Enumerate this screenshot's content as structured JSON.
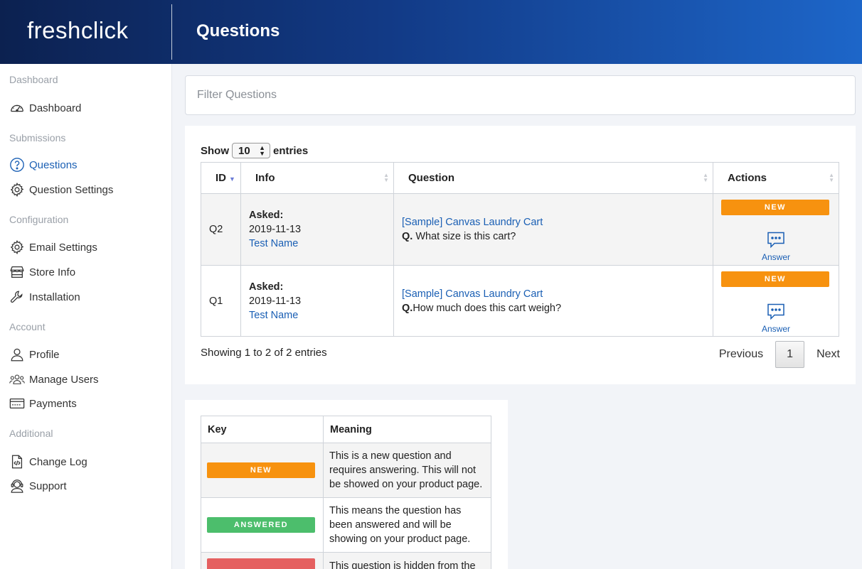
{
  "app": {
    "logo": "freshclick",
    "page_title": "Questions"
  },
  "sidebar": {
    "sections": [
      {
        "label": "Dashboard",
        "items": [
          {
            "label": "Dashboard",
            "icon": "gauge-icon"
          }
        ]
      },
      {
        "label": "Submissions",
        "items": [
          {
            "label": "Questions",
            "icon": "question-circle-icon",
            "active": true
          },
          {
            "label": "Question Settings",
            "icon": "gear-icon"
          }
        ]
      },
      {
        "label": "Configuration",
        "items": [
          {
            "label": "Email Settings",
            "icon": "gear-icon"
          },
          {
            "label": "Store Info",
            "icon": "store-icon"
          },
          {
            "label": "Installation",
            "icon": "wrench-icon"
          }
        ]
      },
      {
        "label": "Account",
        "items": [
          {
            "label": "Profile",
            "icon": "user-icon"
          },
          {
            "label": "Manage Users",
            "icon": "users-icon"
          },
          {
            "label": "Payments",
            "icon": "card-icon"
          }
        ]
      },
      {
        "label": "Additional",
        "items": [
          {
            "label": "Change Log",
            "icon": "code-file-icon"
          },
          {
            "label": "Support",
            "icon": "headset-icon"
          }
        ]
      }
    ]
  },
  "filter": {
    "placeholder": "Filter Questions"
  },
  "table": {
    "show_label": "Show",
    "entries_label": "entries",
    "page_size": "10",
    "columns": [
      "ID",
      "Info",
      "Question",
      "Actions"
    ],
    "rows": [
      {
        "id": "Q2",
        "asked_label": "Asked:",
        "date": "2019-11-13",
        "name": "Test Name",
        "product": "[Sample] Canvas Laundry Cart",
        "q_prefix": "Q.",
        "question": " What size is this cart?",
        "status": "NEW",
        "action": "Answer"
      },
      {
        "id": "Q1",
        "asked_label": "Asked:",
        "date": "2019-11-13",
        "name": "Test Name",
        "product": "[Sample] Canvas Laundry Cart",
        "q_prefix": "Q.",
        "question": "How much does this cart weigh?",
        "status": "NEW",
        "action": "Answer"
      }
    ],
    "showing": "Showing 1 to 2 of 2 entries",
    "pager": {
      "previous": "Previous",
      "page": "1",
      "next": "Next"
    }
  },
  "key": {
    "columns": [
      "Key",
      "Meaning"
    ],
    "rows": [
      {
        "badge": "NEW",
        "meaning": "This is a new question and requires answering. This will not be showed on your product page."
      },
      {
        "badge": "ANSWERED",
        "meaning": "This means the question has been answered and will be showing on your product page."
      },
      {
        "badge": "",
        "meaning": "This question is hidden from the"
      }
    ]
  },
  "colors": {
    "new": "#f7920f",
    "answered": "#4cbe6c",
    "hidden": "#e56060",
    "link": "#1a5fb4"
  }
}
